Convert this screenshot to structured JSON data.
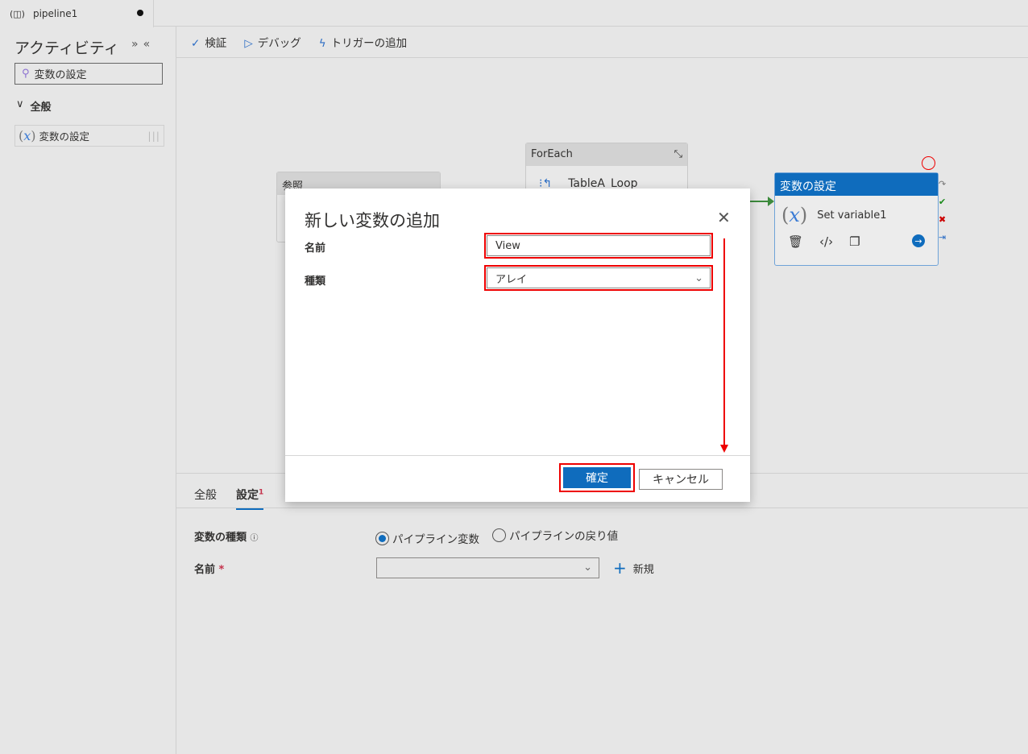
{
  "tab": {
    "title": "pipeline1"
  },
  "sidebar": {
    "title": "アクティビティ",
    "search_value": "変数の設定",
    "group": "全般",
    "item": "変数の設定"
  },
  "toolbar": {
    "validate": "検証",
    "debug": "デバッグ",
    "add_trigger": "トリガーの追加"
  },
  "canvas": {
    "ref_node": "参照",
    "foreach_node": "ForEach",
    "foreach_inner": "TableA_Loop",
    "setvar_header": "変数の設定",
    "setvar_name": "Set variable1"
  },
  "bottom": {
    "tabs": [
      "全般",
      "設定"
    ],
    "settings_badge": "1",
    "var_type_label": "変数の種類",
    "options": [
      "パイプライン変数",
      "パイプラインの戻り値"
    ],
    "name_label": "名前",
    "required": "*",
    "new_label": "新規"
  },
  "dialog": {
    "title": "新しい変数の追加",
    "name_label": "名前",
    "name_value": "View",
    "type_label": "種類",
    "type_value": "アレイ",
    "ok": "確定",
    "cancel": "キャンセル"
  },
  "colors": {
    "accent": "#0f6cbd",
    "highlight": "#e00000"
  }
}
